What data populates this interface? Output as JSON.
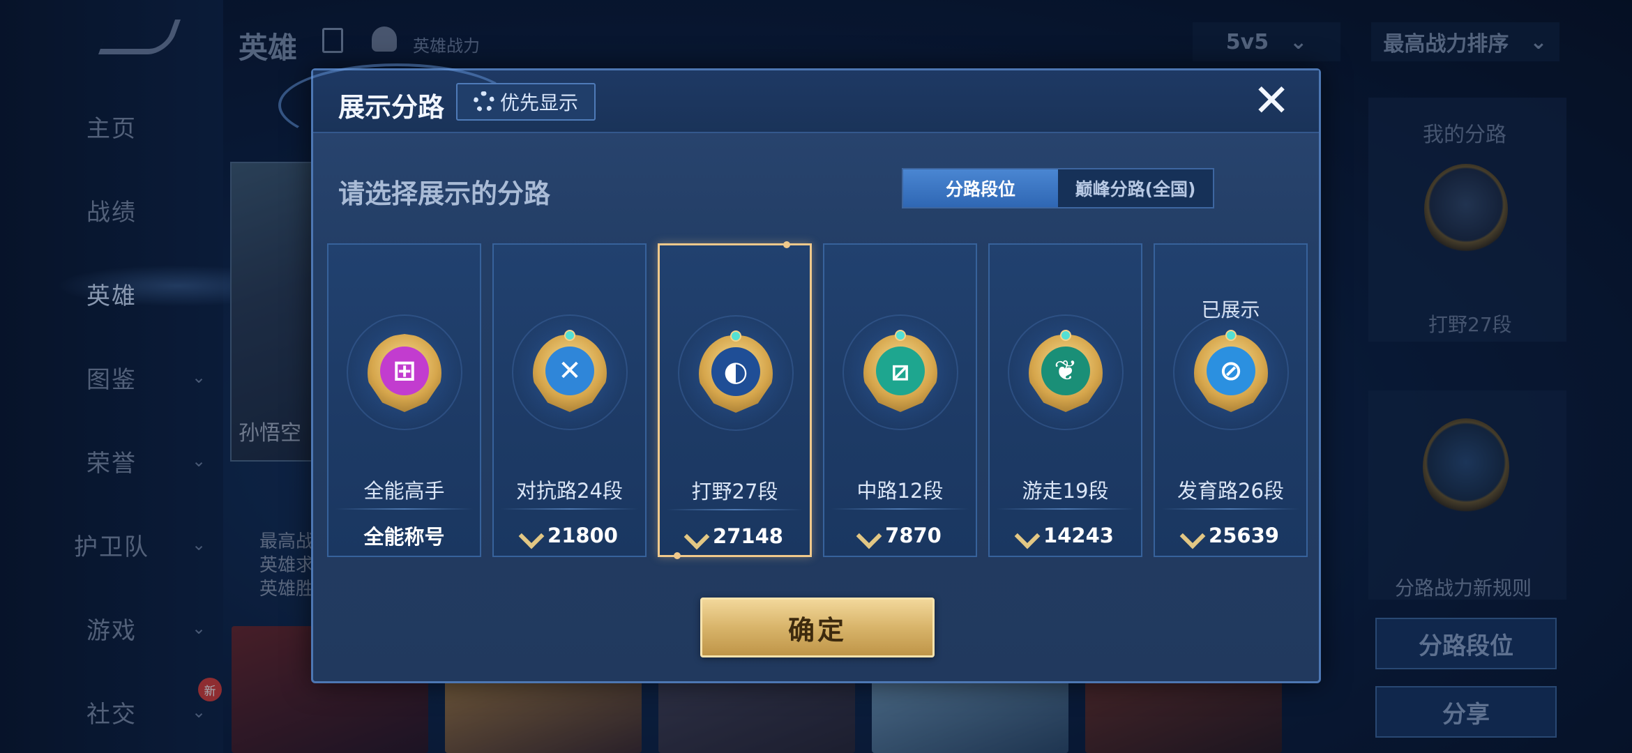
{
  "background": {
    "left_nav": [
      {
        "label": "主页",
        "chevron": false
      },
      {
        "label": "战绩",
        "chevron": false
      },
      {
        "label": "英雄",
        "chevron": false,
        "active": true
      },
      {
        "label": "图鉴",
        "chevron": true
      },
      {
        "label": "荣誉",
        "chevron": true
      },
      {
        "label": "护卫队",
        "chevron": true
      },
      {
        "label": "游戏",
        "chevron": true
      },
      {
        "label": "社交",
        "chevron": true
      }
    ],
    "new_badge": "新",
    "top_title": "英雄",
    "power_label": "英雄战力",
    "mode_dropdown": "5v5",
    "sort_dropdown": "最高战力排序",
    "hero_card": {
      "name": "孙悟空",
      "stats": [
        "最高战",
        "英雄求",
        "英雄胜"
      ]
    },
    "right_panel": {
      "title": "我的分路",
      "label": "打野27段",
      "rule_link": "分路战力新规则",
      "lane_button": "分路段位",
      "share_button": "分享"
    }
  },
  "dialog": {
    "title": "展示分路",
    "priority_button": "优先显示",
    "close_symbol": "✕",
    "subtitle": "请选择展示的分路",
    "tabs": [
      {
        "label": "分路段位",
        "active": true
      },
      {
        "label": "巅峰分路(全国)",
        "active": false
      }
    ],
    "cards": [
      {
        "name": "全能高手",
        "footer": "全能称号",
        "power_icon": false,
        "core_color": "#c23ccf",
        "core_glyph": "⊞",
        "badge": ""
      },
      {
        "name": "对抗路24段",
        "footer": "21800",
        "power_icon": true,
        "core_color": "#2f86d9",
        "core_glyph": "✕",
        "badge": ""
      },
      {
        "name": "打野27段",
        "footer": "27148",
        "power_icon": true,
        "core_color": "#1f4e96",
        "core_glyph": "◐",
        "badge": "",
        "selected": true
      },
      {
        "name": "中路12段",
        "footer": "7870",
        "power_icon": true,
        "core_color": "#1ea68f",
        "core_glyph": "⧄",
        "badge": ""
      },
      {
        "name": "游走19段",
        "footer": "14243",
        "power_icon": true,
        "core_color": "#1a8f77",
        "core_glyph": "❦",
        "badge": ""
      },
      {
        "name": "发育路26段",
        "footer": "25639",
        "power_icon": true,
        "core_color": "#2b90e0",
        "core_glyph": "⊘",
        "badge": "已展示"
      }
    ],
    "confirm_button": "确定"
  }
}
